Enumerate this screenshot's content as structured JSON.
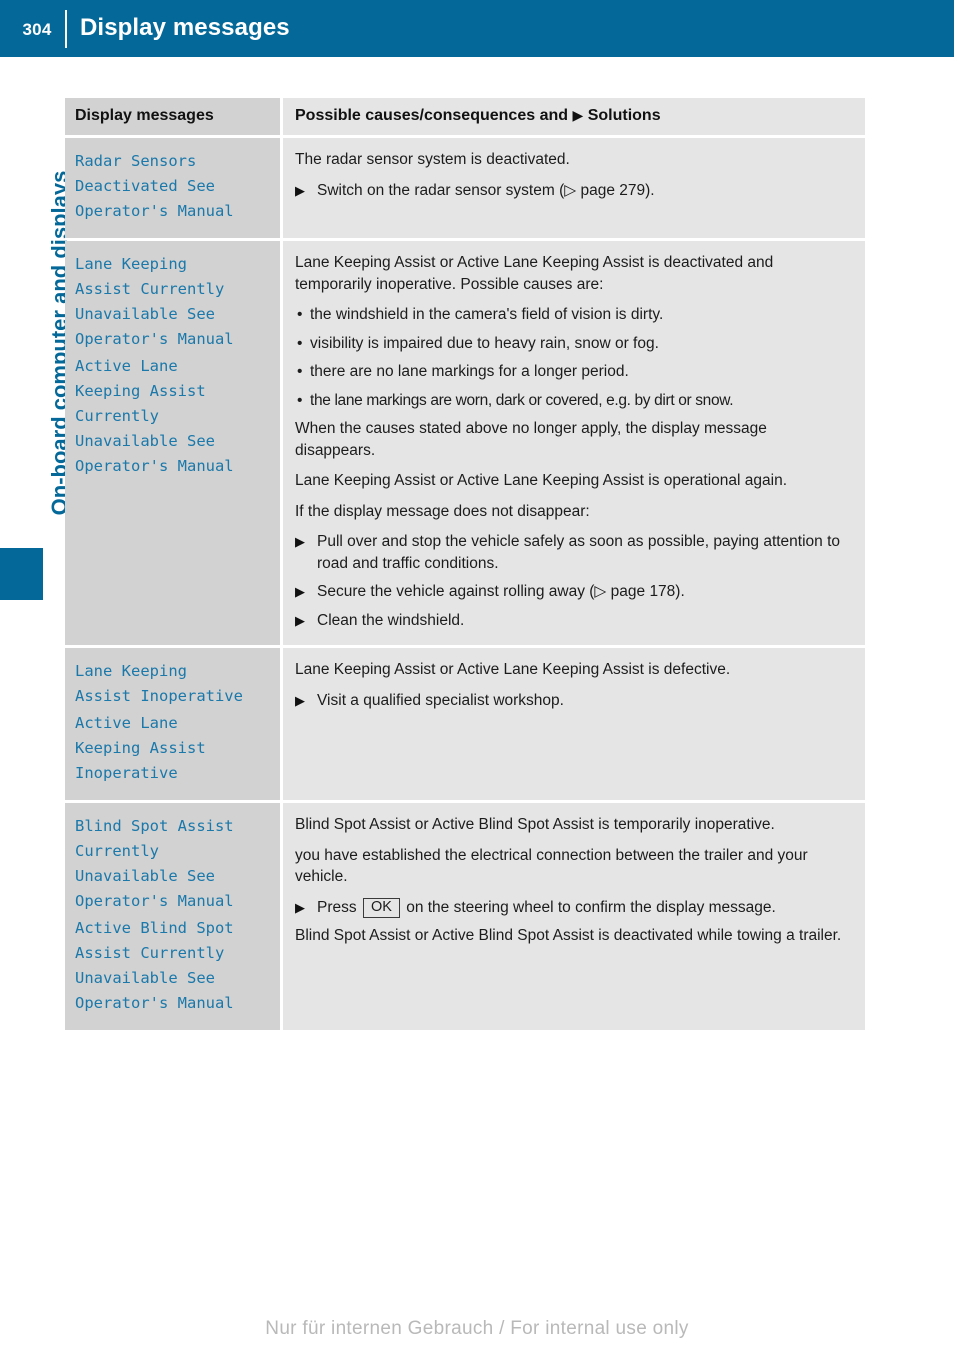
{
  "header": {
    "page_number": "304",
    "title": "Display messages"
  },
  "side_label": "On-board computer and displays",
  "table": {
    "columns": {
      "left": "Display messages",
      "right_prefix": "Possible causes/consequences and",
      "right_triangle": "▶",
      "right_suffix": "Solutions"
    },
    "rows": [
      {
        "messages": [
          "Radar Sensors\nDeactivated See\nOperator's Manual"
        ],
        "content": [
          {
            "kind": "para",
            "text": "The radar sensor system is deactivated."
          },
          {
            "kind": "step",
            "text": "Switch on the radar sensor system (▷ page 279)."
          }
        ]
      },
      {
        "messages": [
          "Lane Keeping\nAssist Currently\nUnavailable See\nOperator's Manual",
          "Active Lane\nKeeping Assist\nCurrently\nUnavailable See\nOperator's Manual"
        ],
        "content": [
          {
            "kind": "para",
            "text": "Lane Keeping Assist or Active Lane Keeping Assist is deactivated and temporarily inoperative. Possible causes are:"
          },
          {
            "kind": "bullet",
            "text": "the windshield in the camera's field of vision is dirty."
          },
          {
            "kind": "bullet",
            "text": "visibility is impaired due to heavy rain, snow or fog."
          },
          {
            "kind": "bullet",
            "text": "there are no lane markings for a longer period."
          },
          {
            "kind": "bullet",
            "tight": true,
            "text": "the lane markings are worn, dark or covered, e.g. by dirt or snow."
          },
          {
            "kind": "para",
            "text": "When the causes stated above no longer apply, the display message disappears."
          },
          {
            "kind": "para",
            "text": "Lane Keeping Assist or Active Lane Keeping Assist is operational again."
          },
          {
            "kind": "para",
            "text": "If the display message does not disappear:"
          },
          {
            "kind": "step",
            "text": "Pull over and stop the vehicle safely as soon as possible, paying attention to road and traffic conditions."
          },
          {
            "kind": "step",
            "text": "Secure the vehicle against rolling away (▷ page 178)."
          },
          {
            "kind": "step",
            "text": "Clean the windshield."
          }
        ]
      },
      {
        "messages": [
          "Lane Keeping\nAssist Inoperative",
          "Active Lane\nKeeping Assist\nInoperative"
        ],
        "content": [
          {
            "kind": "para",
            "text": "Lane Keeping Assist or Active Lane Keeping Assist is defective."
          },
          {
            "kind": "step",
            "text": "Visit a qualified specialist workshop."
          }
        ]
      },
      {
        "messages": [
          "Blind Spot Assist\nCurrently\nUnavailable See\nOperator's Manual",
          "Active Blind Spot\nAssist Currently\nUnavailable See\nOperator's Manual"
        ],
        "content": [
          {
            "kind": "para",
            "text": "Blind Spot Assist or Active Blind Spot Assist is temporarily inoperative."
          },
          {
            "kind": "para",
            "text": "you have established the electrical connection between the trailer and your vehicle."
          },
          {
            "kind": "step-ok",
            "text_before": "Press",
            "button": "OK",
            "text_after": "on the steering wheel to confirm the display message."
          },
          {
            "kind": "para",
            "text": "Blind Spot Assist or Active Blind Spot Assist is deactivated while towing a trailer."
          }
        ]
      }
    ]
  },
  "footer": "Nur für internen Gebrauch / For internal use only",
  "colors": {
    "brand_blue": "#046999",
    "message_blue": "#1a78aa",
    "cell_left_bg": "#d2d2d2",
    "cell_right_bg": "#e5e5e5"
  }
}
